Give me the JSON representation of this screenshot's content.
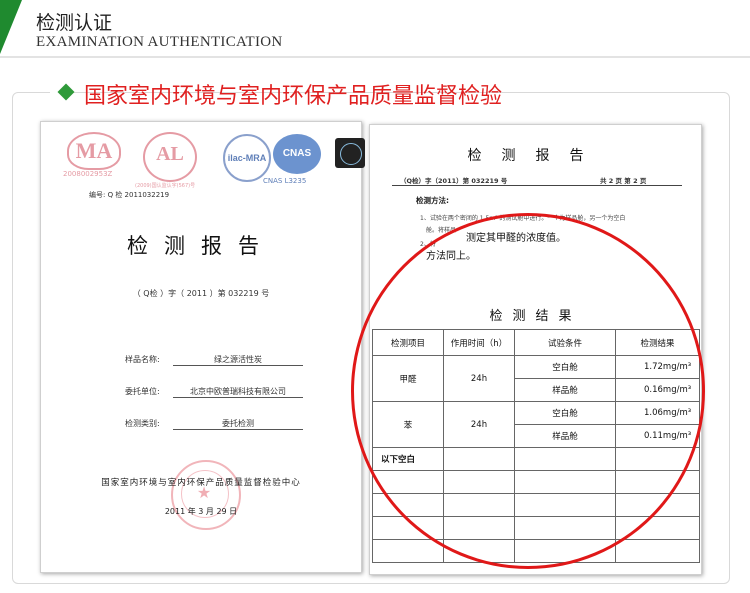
{
  "header": {
    "title_cn": "检测认证",
    "title_en": "EXAMINATION AUTHENTICATION"
  },
  "section": {
    "title": "国家室内环境与室内环保产品质量监督检验"
  },
  "colors": {
    "accent_green": "#1f8a2f",
    "section_red": "#e02020",
    "circle_red": "#e01818"
  },
  "doc1": {
    "logo_ma_number": "2008002953Z",
    "logo_cal_sub": "(2009)国认监认字(567)号",
    "logo_ilac": "ilac-MRA",
    "logo_cnas": "CNAS",
    "logo_cnas_sub": "CNAS L3235",
    "number": "编号: Q 检 2011032219",
    "title": "检测报告",
    "code": "（ Q检 ）字（ 2011 ）第 032219 号",
    "sample_label": "样品名称:",
    "sample_value": "绿之源活性炭",
    "client_label": "委托单位:",
    "client_value": "北京中欧普瑞科技有限公司",
    "type_label": "检测类别:",
    "type_value": "委托检测",
    "org": "国家室内环境与室内环保产品质量监督检验中心",
    "date": "2011 年 3 月 29 日"
  },
  "doc2": {
    "title": "检测报告",
    "code": "（Q检）字（2011）第 032219 号",
    "page": "共 2 页 第 2 页",
    "method_heading": "检测方法:",
    "method_line1": "1、试验在两个密闭的 1.5m³ 的测试舱中进行。一个为样品舱，另一个为空白",
    "method_line2": "舱。将样品",
    "method_big1": "测定其甲醛的浓度值。",
    "method_line3": "2、将",
    "method_big2": "方法同上。",
    "results_title": "检测结果",
    "table": {
      "headers": [
        "检测项目",
        "作用时间（h）",
        "试验条件",
        "检测结果"
      ],
      "groups": [
        {
          "item": "甲醛",
          "time": "24h",
          "rows": [
            {
              "cond": "空白舱",
              "result": "1.72mg/m³"
            },
            {
              "cond": "样品舱",
              "result": "0.16mg/m³"
            }
          ]
        },
        {
          "item": "苯",
          "time": "24h",
          "rows": [
            {
              "cond": "空白舱",
              "result": "1.06mg/m³"
            },
            {
              "cond": "样品舱",
              "result": "0.11mg/m³"
            }
          ]
        }
      ],
      "blank_note": "以下空白"
    }
  }
}
